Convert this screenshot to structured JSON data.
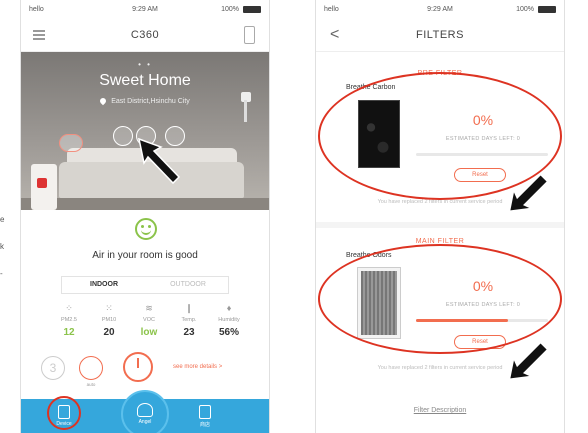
{
  "left_edge_fragments": [
    "e",
    "k",
    "-"
  ],
  "phone1": {
    "status": {
      "carrier": "hello",
      "time": "9:29 AM",
      "battery": "100%"
    },
    "nav": {
      "title": "C360"
    },
    "hero": {
      "title": "Sweet Home",
      "location": "East District,Hsinchu City",
      "page_dots": "• •"
    },
    "status_face": "happy-face-icon",
    "air_message": "Air in your room is good",
    "tabs": [
      {
        "label": "INDOOR",
        "active": true
      },
      {
        "label": "OUTDOOR",
        "active": false
      }
    ],
    "metrics": [
      {
        "name": "PM2.5",
        "value": "12",
        "color": "#8bc34a",
        "icon": "pm25-icon"
      },
      {
        "name": "PM10",
        "value": "20",
        "color": "#333333",
        "icon": "pm10-icon"
      },
      {
        "name": "VOC",
        "value": "low",
        "color": "#8bc34a",
        "icon": "voc-icon"
      },
      {
        "name": "Temp.",
        "value": "23",
        "color": "#333333",
        "icon": "thermometer-icon"
      },
      {
        "name": "Humidity",
        "value": "56%",
        "color": "#333333",
        "icon": "droplet-icon"
      }
    ],
    "fan_level": "3",
    "auto_label": "auto",
    "see_more": "see more details >",
    "tabbar": [
      {
        "label": "Device",
        "icon": "purifier-icon"
      },
      {
        "label": "Angel",
        "icon": "angel-icon"
      },
      {
        "label": "商店",
        "icon": "cart-icon"
      }
    ]
  },
  "phone2": {
    "status": {
      "carrier": "hello",
      "time": "9:29 AM",
      "battery": "100%"
    },
    "nav": {
      "title": "FILTERS",
      "back": "<"
    },
    "pre_filter": {
      "section": "PRE FILTER",
      "name": "Breathe Carbon",
      "percent": "0%",
      "progress": 0,
      "days_left": "ESTIMATED DAYS LEFT: 0",
      "reset": "Reset",
      "replaced": "You have replaced 2 filters in current service period"
    },
    "main_filter": {
      "section": "MAIN FILTER",
      "name": "Breathe Odors",
      "percent": "0%",
      "progress": 0.7,
      "days_left": "ESTIMATED DAYS LEFT: 0",
      "reset": "Reset",
      "replaced": "You have replaced 2 filters in current service period"
    },
    "filter_description": "Filter Description"
  },
  "colors": {
    "accent": "#f26d4f",
    "tabbar": "#35a7dc",
    "good": "#8bc34a",
    "annotation": "#d32f2f"
  }
}
